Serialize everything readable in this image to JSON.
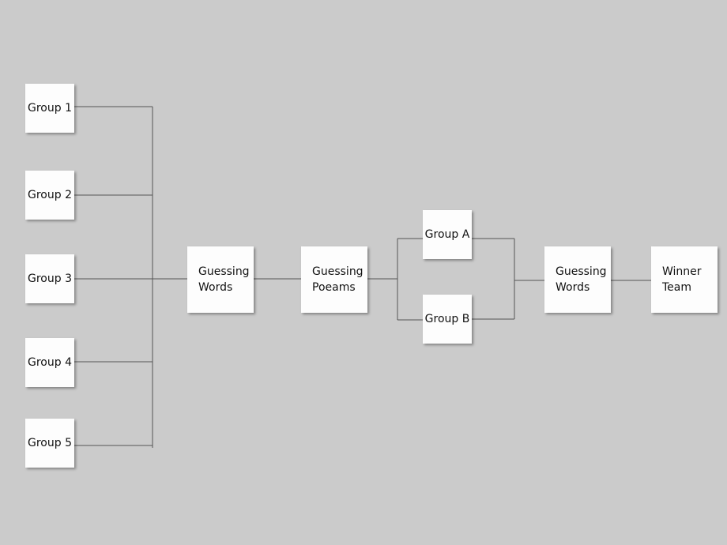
{
  "first_round": [
    "Group 1",
    "Group 2",
    "Group 3",
    "Group 4",
    "Group 5"
  ],
  "stage1": {
    "line1": "Guessing",
    "line2": "Words"
  },
  "stage2": {
    "line1": "Guessing",
    "line2": "Poeams"
  },
  "semi": [
    "Group A",
    "Group B"
  ],
  "stage3": {
    "line1": "Guessing",
    "line2": "Words"
  },
  "winner": {
    "line1": "Winner",
    "line2": "Team"
  }
}
